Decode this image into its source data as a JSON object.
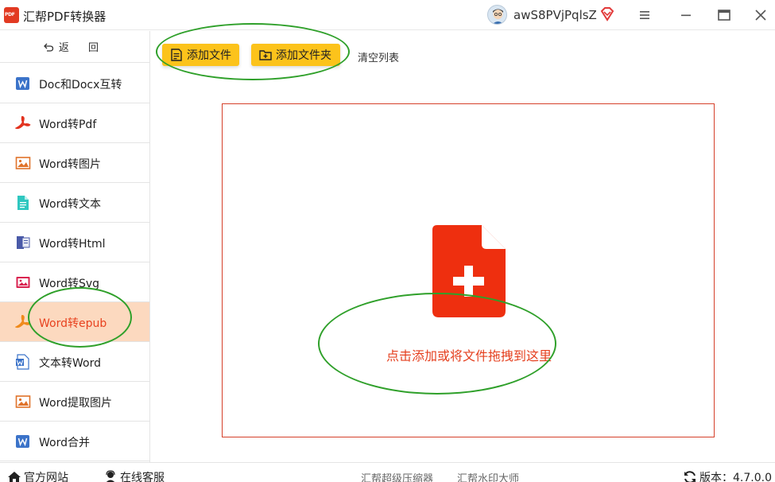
{
  "app": {
    "title": "汇帮PDF转换器",
    "logo_text": "PDF",
    "user_name": "awS8PVjPqlsZ"
  },
  "sidebar": {
    "back_label": "返 回",
    "items": [
      {
        "label": "Doc和Docx互转",
        "icon": "word-doc-icon"
      },
      {
        "label": "Word转Pdf",
        "icon": "pdf-icon"
      },
      {
        "label": "Word转图片",
        "icon": "image-icon"
      },
      {
        "label": "Word转文本",
        "icon": "text-file-icon"
      },
      {
        "label": "Word转Html",
        "icon": "html-icon"
      },
      {
        "label": "Word转Svg",
        "icon": "svg-image-icon"
      },
      {
        "label": "Word转epub",
        "icon": "epub-icon",
        "active": true
      },
      {
        "label": "文本转Word",
        "icon": "word-doc-icon"
      },
      {
        "label": "Word提取图片",
        "icon": "image-icon"
      },
      {
        "label": "Word合并",
        "icon": "word-doc-icon"
      }
    ]
  },
  "toolbar": {
    "add_file": "添加文件",
    "add_folder": "添加文件夹",
    "clear_list": "清空列表"
  },
  "dropzone": {
    "text": "点击添加或将文件拖拽到这里"
  },
  "footer": {
    "website": "官方网站",
    "support": "在线客服",
    "link_compressor": "汇帮超级压缩器",
    "link_watermark": "汇帮水印大师",
    "version": "版本：4.7.0.0"
  },
  "colors": {
    "accent_yellow": "#fcc31b",
    "active_bg": "#fcd9bf",
    "active_text": "#e8421f",
    "drop_red": "#e5401f",
    "annotation_green": "#2fa02a"
  }
}
